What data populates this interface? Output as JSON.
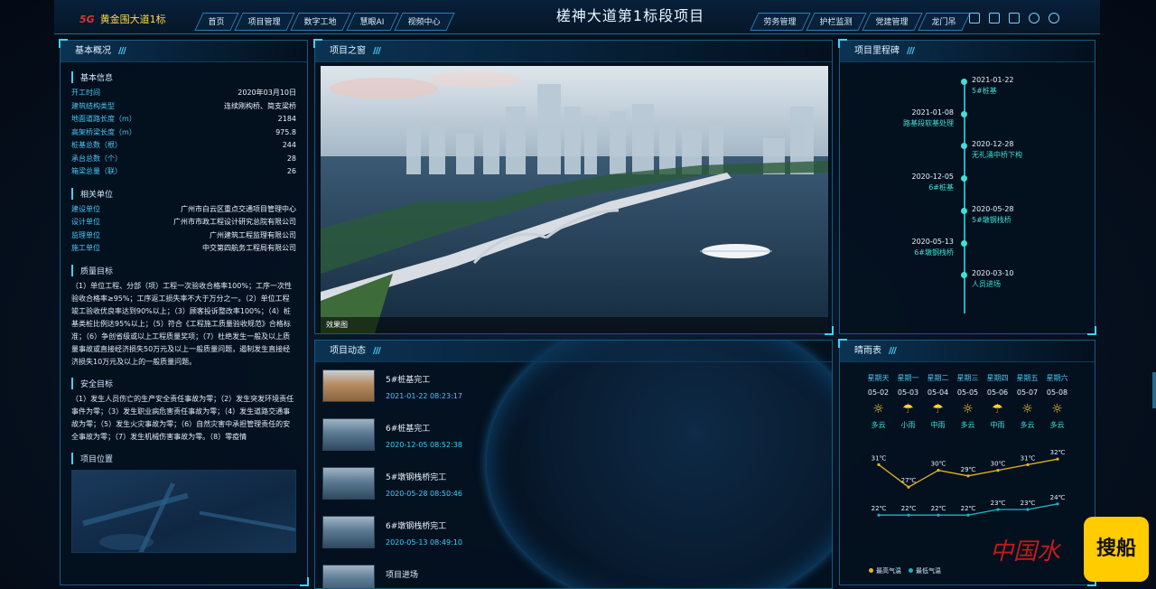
{
  "header": {
    "brand_tag": "5G",
    "brand": "黄金围大道1标",
    "title": "槎神大道第1标段项目",
    "nav_left": [
      "首页",
      "项目管理",
      "数字工地",
      "慧眼AI",
      "视频中心"
    ],
    "nav_right": [
      "劳务管理",
      "护栏监测",
      "党建管理",
      "龙门吊"
    ],
    "icons": [
      "monitor-icon",
      "screen-icon",
      "document-icon",
      "gear-icon",
      "power-icon"
    ]
  },
  "overview": {
    "title": "基本概况",
    "basic": {
      "label": "基本信息",
      "rows": [
        {
          "k": "开工时间",
          "v": "2020年03月10日"
        },
        {
          "k": "建筑结构类型",
          "v": "连续刚构桥、简支梁桥"
        },
        {
          "k": "地面道路长度（m）",
          "v": "2184"
        },
        {
          "k": "高架桥梁长度（m）",
          "v": "975.8"
        },
        {
          "k": "桩基总数（根）",
          "v": "244"
        },
        {
          "k": "承台总数（个）",
          "v": "28"
        },
        {
          "k": "箱梁总量（联）",
          "v": "26"
        }
      ]
    },
    "units": {
      "label": "相关单位",
      "rows": [
        {
          "k": "建设单位",
          "v": "广州市白云区重点交通项目管理中心"
        },
        {
          "k": "设计单位",
          "v": "广州市市政工程设计研究总院有限公司"
        },
        {
          "k": "监理单位",
          "v": "广州建筑工程监理有限公司"
        },
        {
          "k": "施工单位",
          "v": "中交第四航务工程局有限公司"
        }
      ]
    },
    "quality": {
      "label": "质量目标",
      "text": "（1）单位工程、分部（项）工程一次验收合格率100%；工序一次性验收合格率≥95%；工序返工损失率不大于万分之一。（2）单位工程竣工验收优良率达到90%以上；（3）顾客投诉整改率100%；（4）桩基类桩比例达95%以上；（5）符合《工程施工质量验收规范》合格标准；（6）争创省级或以上工程质量奖项；（7）杜绝发生一般及以上质量事故或直接经济损失50万元及以上一般质量问题，遏制发生直接经济损失10万元及以上的一般质量问题。"
    },
    "safety": {
      "label": "安全目标",
      "text": "（1）发生人员伤亡的生产安全责任事故为零；（2）发生突发环境责任事件为零；（3）发生职业病危害责任事故为零；（4）发生道路交通事故为零；（5）发生火灾事故为零；（6）自然灾害中承担管理责任的安全事故为零；（7）发生机械伤害事故为零。（8）零疫情"
    },
    "location": {
      "label": "项目位置"
    }
  },
  "window": {
    "title": "项目之窗",
    "caption": "效果图"
  },
  "news": {
    "title": "项目动态",
    "items": [
      {
        "title": "5#桩基完工",
        "date": "2021-01-22 08:23:17"
      },
      {
        "title": "6#桩基完工",
        "date": "2020-12-05 08:52:38"
      },
      {
        "title": "5#墩钢栈桥完工",
        "date": "2020-05-28 08:50:46"
      },
      {
        "title": "6#墩钢栈桥完工",
        "date": "2020-05-13 08:49:10"
      },
      {
        "title": "项目进场",
        "date": ""
      }
    ]
  },
  "milestones": {
    "title": "项目里程碑",
    "items": [
      {
        "date": "2021-01-22",
        "name": "5#桩基",
        "side": "r"
      },
      {
        "date": "2021-01-08",
        "name": "路基段软基处理",
        "side": "l"
      },
      {
        "date": "2020-12-28",
        "name": "无礼涌中桥下构",
        "side": "r"
      },
      {
        "date": "2020-12-05",
        "name": "6#桩基",
        "side": "l"
      },
      {
        "date": "2020-05-28",
        "name": "5#墩钢栈桥",
        "side": "r"
      },
      {
        "date": "2020-05-13",
        "name": "6#墩钢栈桥",
        "side": "l"
      },
      {
        "date": "2020-03-10",
        "name": "人员进场",
        "side": "r"
      }
    ]
  },
  "weather": {
    "title": "晴雨表",
    "days": [
      {
        "week": "星期天",
        "date": "05-02",
        "icon": "partly-cloudy-icon",
        "desc": "多云"
      },
      {
        "week": "星期一",
        "date": "05-03",
        "icon": "light-rain-icon",
        "desc": "小雨"
      },
      {
        "week": "星期二",
        "date": "05-04",
        "icon": "moderate-rain-icon",
        "desc": "中雨"
      },
      {
        "week": "星期三",
        "date": "05-05",
        "icon": "partly-cloudy-icon",
        "desc": "多云"
      },
      {
        "week": "星期四",
        "date": "05-06",
        "icon": "moderate-rain-icon",
        "desc": "中雨"
      },
      {
        "week": "星期五",
        "date": "05-07",
        "icon": "partly-cloudy-icon",
        "desc": "多云"
      },
      {
        "week": "星期六",
        "date": "05-08",
        "icon": "partly-cloudy-icon",
        "desc": "多云"
      }
    ],
    "high_color": "#e2b526",
    "low_color": "#1fb2c5",
    "legend_high": "最高气温",
    "legend_low": "最低气温"
  },
  "chart_data": {
    "type": "line",
    "categories": [
      "05-02",
      "05-03",
      "05-04",
      "05-05",
      "05-06",
      "05-07",
      "05-08"
    ],
    "series": [
      {
        "name": "最高气温",
        "values": [
          31,
          27,
          30,
          29,
          30,
          31,
          32
        ]
      },
      {
        "name": "最低气温",
        "values": [
          22,
          22,
          22,
          22,
          23,
          23,
          24
        ]
      }
    ],
    "unit": "℃"
  },
  "watermark": {
    "left": "中国水",
    "right": "搜船"
  }
}
